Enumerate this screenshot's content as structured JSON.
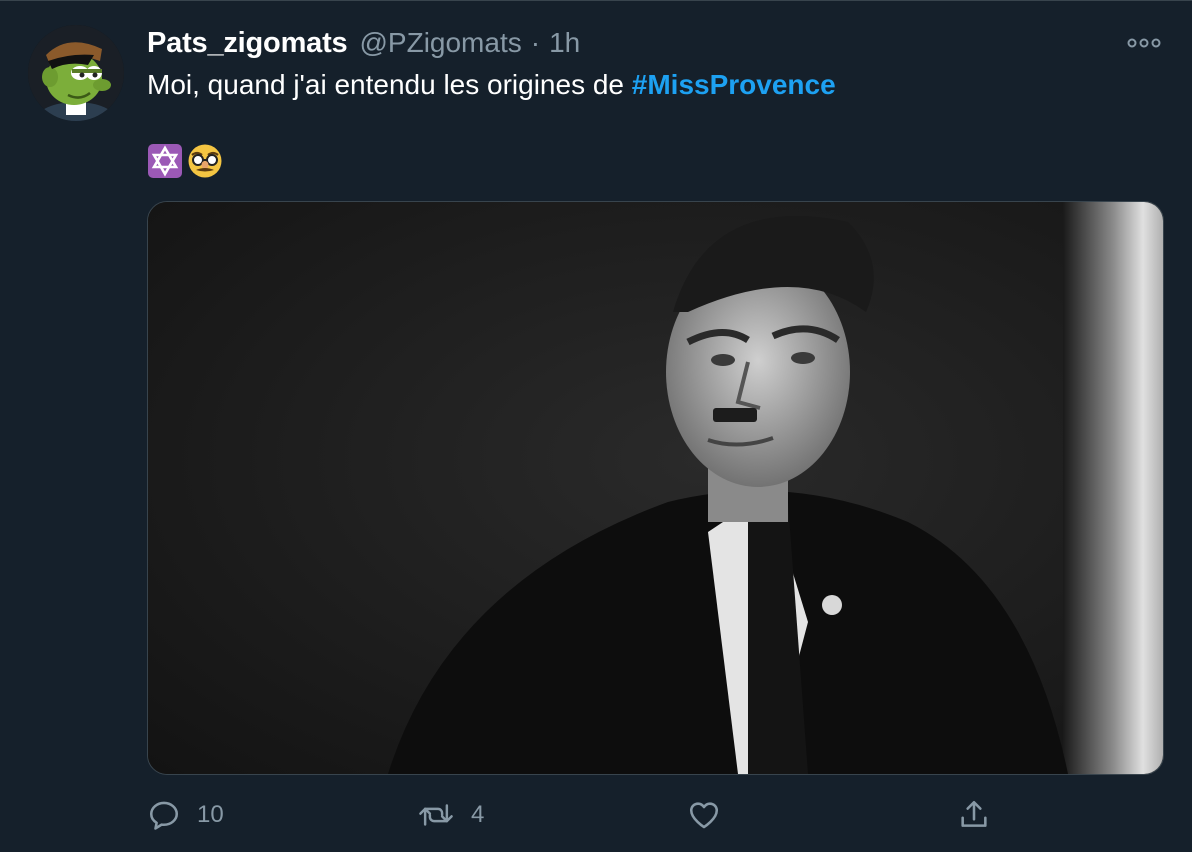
{
  "tweet": {
    "author": {
      "display_name": "Pats_zigomats",
      "handle": "@PZigomats",
      "separator": "·",
      "time": "1h"
    },
    "text": {
      "prefix": "Moi, quand j'ai entendu les origines de ",
      "hashtag": "#MissProvence"
    },
    "emojis": [
      "star-of-david-icon",
      "disguised-face-icon"
    ],
    "media": {
      "description_icon": "photo"
    },
    "actions": {
      "reply_count": "10",
      "retweet_count": "4",
      "like_count": "",
      "share_count": ""
    }
  },
  "colors": {
    "background": "#15202b",
    "text_primary": "#ffffff",
    "text_secondary": "#8899a6",
    "accent": "#1da1f2",
    "border": "#38444d"
  }
}
